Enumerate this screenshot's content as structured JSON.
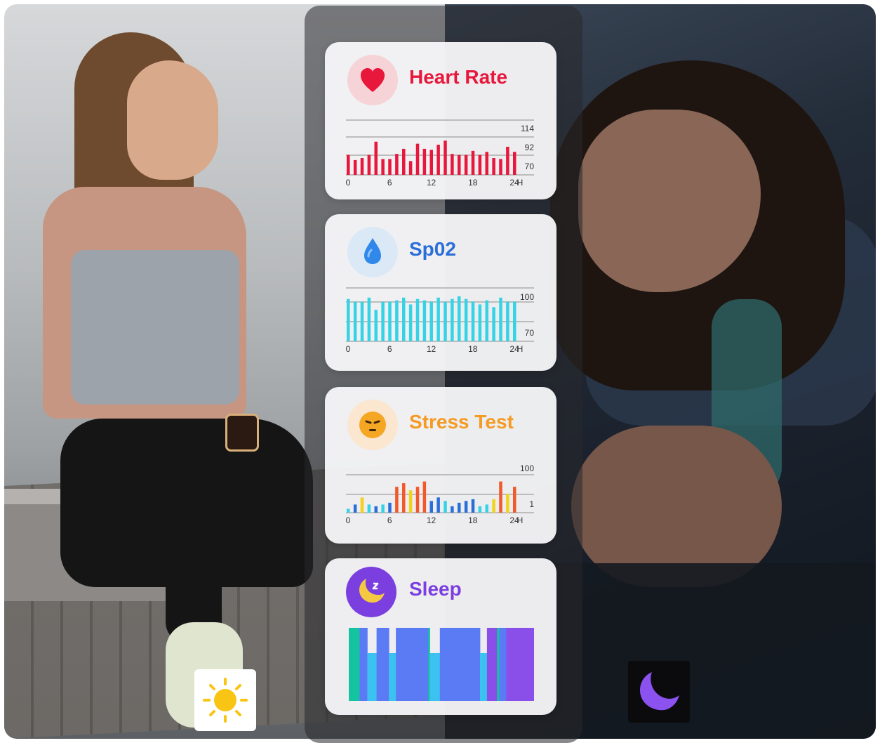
{
  "colors": {
    "heart": "#e8173c",
    "spo2": "#2a6fd9",
    "stress": "#f59a23",
    "sleep": "#7b3fe0",
    "spo2_bar": "#35d3e6",
    "grid": "#bdbdbd"
  },
  "icons": {
    "heart": "heart-icon",
    "drop": "water-drop-icon",
    "stress": "stressed-face-icon",
    "sleep": "moon-zzz-icon",
    "sun": "sun-icon",
    "moon": "moon-icon"
  },
  "cards": {
    "heart_rate": {
      "title": "Heart Rate"
    },
    "spo2": {
      "title": "Sp02"
    },
    "stress": {
      "title": "Stress Test"
    },
    "sleep": {
      "title": "Sleep"
    }
  },
  "chart_data": [
    {
      "type": "bar",
      "name": "heart_rate",
      "x_ticks": [
        "0",
        "6",
        "12",
        "18",
        "24"
      ],
      "x_unit": "H",
      "y_ticks": [
        "114",
        "92",
        "70"
      ],
      "ylim": [
        70,
        114
      ],
      "values": [
        84,
        79,
        81,
        84,
        97,
        80,
        80,
        85,
        90,
        78,
        95,
        90,
        89,
        94,
        98,
        85,
        84,
        84,
        88,
        84,
        87,
        81,
        80,
        92,
        87
      ],
      "color": "#e8173c",
      "grid": true
    },
    {
      "type": "bar",
      "name": "spo2",
      "x_ticks": [
        "0",
        "6",
        "12",
        "18",
        "24"
      ],
      "x_unit": "H",
      "y_ticks": [
        "100",
        "70"
      ],
      "ylim": [
        70,
        100
      ],
      "values": [
        96,
        94,
        94,
        97,
        88,
        94,
        94,
        95,
        97,
        92,
        96,
        95,
        94,
        97,
        94,
        96,
        98,
        96,
        94,
        92,
        95,
        90,
        97,
        94,
        94
      ],
      "color": "#35d3e6",
      "grid": true
    },
    {
      "type": "bar",
      "name": "stress",
      "x_ticks": [
        "0",
        "6",
        "12",
        "18",
        "24"
      ],
      "x_unit": "H",
      "y_ticks": [
        "100",
        "1"
      ],
      "ylim": [
        1,
        100
      ],
      "values": [
        8,
        20,
        40,
        20,
        15,
        20,
        25,
        70,
        80,
        60,
        70,
        85,
        30,
        40,
        30,
        15,
        25,
        30,
        35,
        15,
        20,
        35,
        85,
        50,
        70
      ],
      "colors": [
        "#35d3e6",
        "#2a6fd9",
        "#f2d21d",
        "#35d3e6",
        "#2a6fd9",
        "#35d3e6",
        "#2a6fd9",
        "#f2582a",
        "#f2582a",
        "#f2d21d",
        "#f2582a",
        "#f2582a",
        "#2a6fd9",
        "#2a6fd9",
        "#35d3e6",
        "#2a6fd9",
        "#2a6fd9",
        "#2a6fd9",
        "#2a6fd9",
        "#35d3e6",
        "#35d3e6",
        "#f2d21d",
        "#f2582a",
        "#f2d21d",
        "#f2582a"
      ],
      "grid": true
    },
    {
      "type": "bar",
      "name": "sleep_stages",
      "segments": [
        {
          "stage": "awake",
          "start": 0,
          "end": 1.4,
          "level": 1
        },
        {
          "stage": "light",
          "start": 1.4,
          "end": 2.4,
          "level": 2
        },
        {
          "stage": "deep",
          "start": 2.4,
          "end": 3.6,
          "level": 3
        },
        {
          "stage": "light",
          "start": 3.6,
          "end": 5.2,
          "level": 2
        },
        {
          "stage": "deep",
          "start": 5.2,
          "end": 6.1,
          "level": 3
        },
        {
          "stage": "light",
          "start": 6.1,
          "end": 10.3,
          "level": 2
        },
        {
          "stage": "awake",
          "start": 10.3,
          "end": 10.5,
          "level": 1
        },
        {
          "stage": "deep",
          "start": 10.5,
          "end": 11.8,
          "level": 3
        },
        {
          "stage": "light",
          "start": 11.8,
          "end": 17.0,
          "level": 2
        },
        {
          "stage": "deep",
          "start": 17.0,
          "end": 17.9,
          "level": 3
        },
        {
          "stage": "rem",
          "start": 17.9,
          "end": 19.2,
          "level": 2
        },
        {
          "stage": "awake",
          "start": 19.2,
          "end": 19.5,
          "level": 1
        },
        {
          "stage": "light",
          "start": 19.5,
          "end": 20.4,
          "level": 2
        },
        {
          "stage": "rem",
          "start": 20.4,
          "end": 24.0,
          "level": 2
        }
      ],
      "stage_colors": {
        "awake": "#14c3a0",
        "light": "#5b7bf5",
        "deep": "#3cc2f0",
        "rem": "#8a4fe8"
      }
    }
  ]
}
